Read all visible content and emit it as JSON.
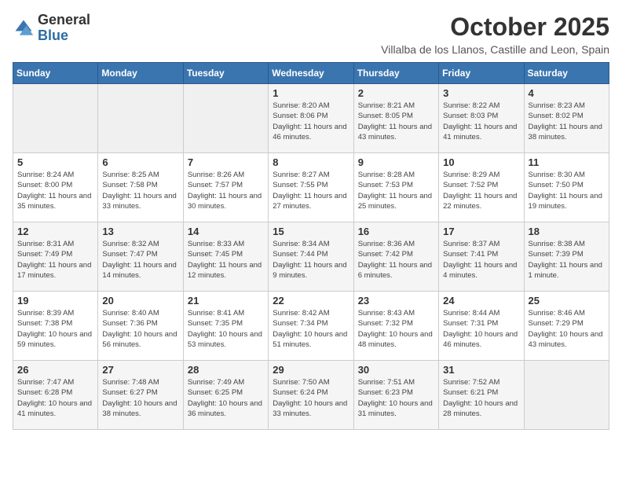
{
  "logo": {
    "general": "General",
    "blue": "Blue"
  },
  "header": {
    "month": "October 2025",
    "location": "Villalba de los Llanos, Castille and Leon, Spain"
  },
  "weekdays": [
    "Sunday",
    "Monday",
    "Tuesday",
    "Wednesday",
    "Thursday",
    "Friday",
    "Saturday"
  ],
  "weeks": [
    [
      {
        "day": "",
        "info": ""
      },
      {
        "day": "",
        "info": ""
      },
      {
        "day": "",
        "info": ""
      },
      {
        "day": "1",
        "info": "Sunrise: 8:20 AM\nSunset: 8:06 PM\nDaylight: 11 hours and 46 minutes."
      },
      {
        "day": "2",
        "info": "Sunrise: 8:21 AM\nSunset: 8:05 PM\nDaylight: 11 hours and 43 minutes."
      },
      {
        "day": "3",
        "info": "Sunrise: 8:22 AM\nSunset: 8:03 PM\nDaylight: 11 hours and 41 minutes."
      },
      {
        "day": "4",
        "info": "Sunrise: 8:23 AM\nSunset: 8:02 PM\nDaylight: 11 hours and 38 minutes."
      }
    ],
    [
      {
        "day": "5",
        "info": "Sunrise: 8:24 AM\nSunset: 8:00 PM\nDaylight: 11 hours and 35 minutes."
      },
      {
        "day": "6",
        "info": "Sunrise: 8:25 AM\nSunset: 7:58 PM\nDaylight: 11 hours and 33 minutes."
      },
      {
        "day": "7",
        "info": "Sunrise: 8:26 AM\nSunset: 7:57 PM\nDaylight: 11 hours and 30 minutes."
      },
      {
        "day": "8",
        "info": "Sunrise: 8:27 AM\nSunset: 7:55 PM\nDaylight: 11 hours and 27 minutes."
      },
      {
        "day": "9",
        "info": "Sunrise: 8:28 AM\nSunset: 7:53 PM\nDaylight: 11 hours and 25 minutes."
      },
      {
        "day": "10",
        "info": "Sunrise: 8:29 AM\nSunset: 7:52 PM\nDaylight: 11 hours and 22 minutes."
      },
      {
        "day": "11",
        "info": "Sunrise: 8:30 AM\nSunset: 7:50 PM\nDaylight: 11 hours and 19 minutes."
      }
    ],
    [
      {
        "day": "12",
        "info": "Sunrise: 8:31 AM\nSunset: 7:49 PM\nDaylight: 11 hours and 17 minutes."
      },
      {
        "day": "13",
        "info": "Sunrise: 8:32 AM\nSunset: 7:47 PM\nDaylight: 11 hours and 14 minutes."
      },
      {
        "day": "14",
        "info": "Sunrise: 8:33 AM\nSunset: 7:45 PM\nDaylight: 11 hours and 12 minutes."
      },
      {
        "day": "15",
        "info": "Sunrise: 8:34 AM\nSunset: 7:44 PM\nDaylight: 11 hours and 9 minutes."
      },
      {
        "day": "16",
        "info": "Sunrise: 8:36 AM\nSunset: 7:42 PM\nDaylight: 11 hours and 6 minutes."
      },
      {
        "day": "17",
        "info": "Sunrise: 8:37 AM\nSunset: 7:41 PM\nDaylight: 11 hours and 4 minutes."
      },
      {
        "day": "18",
        "info": "Sunrise: 8:38 AM\nSunset: 7:39 PM\nDaylight: 11 hours and 1 minute."
      }
    ],
    [
      {
        "day": "19",
        "info": "Sunrise: 8:39 AM\nSunset: 7:38 PM\nDaylight: 10 hours and 59 minutes."
      },
      {
        "day": "20",
        "info": "Sunrise: 8:40 AM\nSunset: 7:36 PM\nDaylight: 10 hours and 56 minutes."
      },
      {
        "day": "21",
        "info": "Sunrise: 8:41 AM\nSunset: 7:35 PM\nDaylight: 10 hours and 53 minutes."
      },
      {
        "day": "22",
        "info": "Sunrise: 8:42 AM\nSunset: 7:34 PM\nDaylight: 10 hours and 51 minutes."
      },
      {
        "day": "23",
        "info": "Sunrise: 8:43 AM\nSunset: 7:32 PM\nDaylight: 10 hours and 48 minutes."
      },
      {
        "day": "24",
        "info": "Sunrise: 8:44 AM\nSunset: 7:31 PM\nDaylight: 10 hours and 46 minutes."
      },
      {
        "day": "25",
        "info": "Sunrise: 8:46 AM\nSunset: 7:29 PM\nDaylight: 10 hours and 43 minutes."
      }
    ],
    [
      {
        "day": "26",
        "info": "Sunrise: 7:47 AM\nSunset: 6:28 PM\nDaylight: 10 hours and 41 minutes."
      },
      {
        "day": "27",
        "info": "Sunrise: 7:48 AM\nSunset: 6:27 PM\nDaylight: 10 hours and 38 minutes."
      },
      {
        "day": "28",
        "info": "Sunrise: 7:49 AM\nSunset: 6:25 PM\nDaylight: 10 hours and 36 minutes."
      },
      {
        "day": "29",
        "info": "Sunrise: 7:50 AM\nSunset: 6:24 PM\nDaylight: 10 hours and 33 minutes."
      },
      {
        "day": "30",
        "info": "Sunrise: 7:51 AM\nSunset: 6:23 PM\nDaylight: 10 hours and 31 minutes."
      },
      {
        "day": "31",
        "info": "Sunrise: 7:52 AM\nSunset: 6:21 PM\nDaylight: 10 hours and 28 minutes."
      },
      {
        "day": "",
        "info": ""
      }
    ]
  ]
}
